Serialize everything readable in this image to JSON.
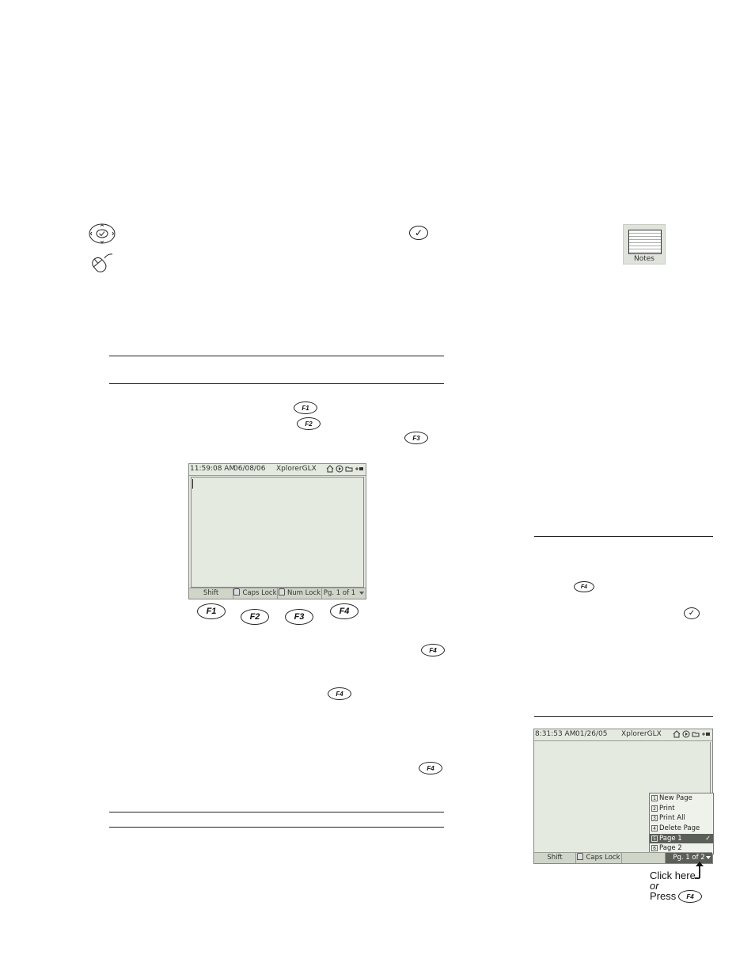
{
  "notes_icon": {
    "label": "Notes"
  },
  "function_keys": {
    "f1": "F1",
    "f2": "F2",
    "f3": "F3",
    "f4": "F4"
  },
  "screen1": {
    "time": "11:59:08 AM",
    "date": "06/08/06",
    "app": "XplorerGLX",
    "softkeys": [
      "Shift",
      "Caps Lock",
      "Num Lock",
      "Pg. 1 of 1"
    ]
  },
  "screen2": {
    "time": "8:31:53 AM",
    "date": "01/26/05",
    "app": "XplorerGLX",
    "softkeys": [
      "Shift",
      "Caps Lock",
      "",
      "Pg. 1 of 2"
    ],
    "menu": [
      {
        "n": "1",
        "label": "New Page"
      },
      {
        "n": "2",
        "label": "Print"
      },
      {
        "n": "3",
        "label": "Print All"
      },
      {
        "n": "4",
        "label": "Delete Page"
      },
      {
        "n": "5",
        "label": "Page 1"
      },
      {
        "n": "6",
        "label": "Page 2"
      }
    ],
    "selected_check": "✓"
  },
  "callout": {
    "line1": "Click here",
    "line2": "or",
    "line3": "Press"
  },
  "icons": [
    "navigation-pad-icon",
    "mouse-icon",
    "check-key-icon",
    "dropdown-arrow-icon"
  ]
}
